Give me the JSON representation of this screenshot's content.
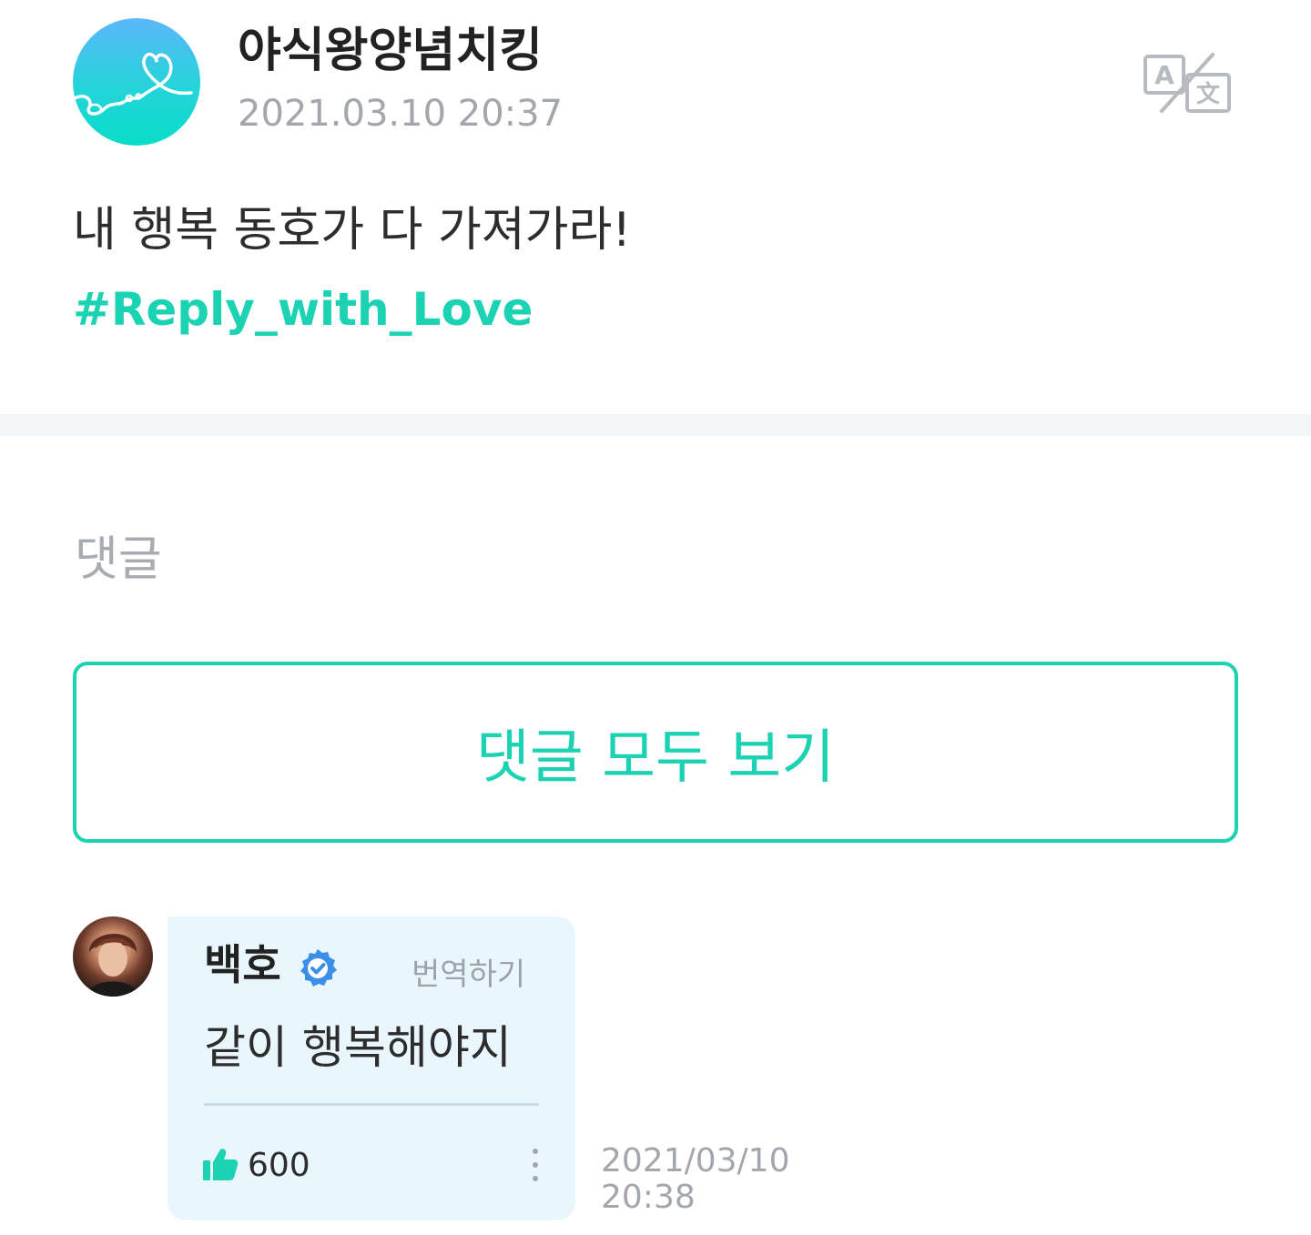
{
  "post": {
    "author": "야식왕양념치킹",
    "timestamp": "2021.03.10 20:37",
    "body": "내 행복 동호가 다 가져가라!",
    "hashtag": "#Reply_with_Love",
    "translate_icon": "translate-icon"
  },
  "comments_section": {
    "title": "댓글",
    "view_all_label": "댓글 모두 보기"
  },
  "comment": {
    "author": "백호",
    "verified_icon": "verified-badge-icon",
    "translate_label": "번역하기",
    "text": "같이 행복해야지",
    "like_icon": "thumbs-up-icon",
    "likes": "600",
    "more_icon": "more-vertical-icon",
    "date": "2021/03/10",
    "time": "20:38"
  },
  "colors": {
    "accent": "#1bd2b3",
    "muted_text": "#a3a6ad",
    "bubble_bg": "#eaf6fd",
    "verified_blue": "#3b8fe8"
  }
}
